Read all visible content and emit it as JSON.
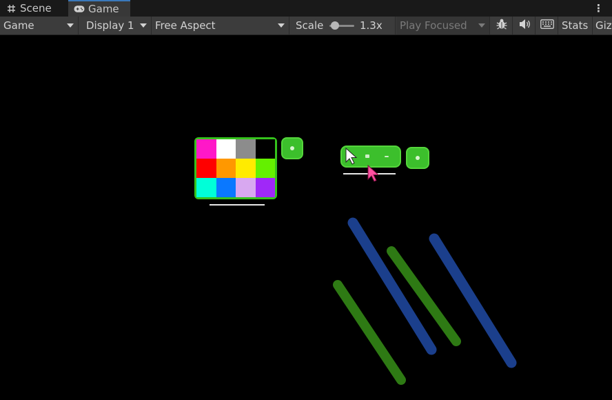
{
  "tabs": {
    "scene_label": "Scene",
    "game_label": "Game"
  },
  "toolbar": {
    "game_view_selector": "Game",
    "display_selector": "Display 1",
    "aspect_selector": "Free Aspect",
    "scale_label": "Scale",
    "scale_value": "1.3x",
    "scale_fraction": 0.1,
    "play_mode_selector": "Play Focused",
    "stats_label": "Stats",
    "gizmos_label": "Giz"
  },
  "icons": {
    "scene_tab": "hash-icon",
    "game_tab": "gamepad-icon",
    "debug": "bug-icon",
    "audio": "speaker-icon",
    "keyboard": "keyboard-icon",
    "menu": "kebab-menu-icon"
  },
  "game": {
    "swatch_colors": [
      "#ff18c8",
      "#ffffff",
      "#8c8c8c",
      "#000000",
      "#ff0000",
      "#ff9800",
      "#ffeb00",
      "#64f000",
      "#00ffd8",
      "#0a78ff",
      "#d8a8f0",
      "#a028f8"
    ],
    "accent_green": "#35c21c",
    "bar_blue": "#1b3f8c",
    "bar_green": "#2e7a14",
    "cursor_white": "#ffffff",
    "cursor_pink": "#ff4fa0"
  }
}
